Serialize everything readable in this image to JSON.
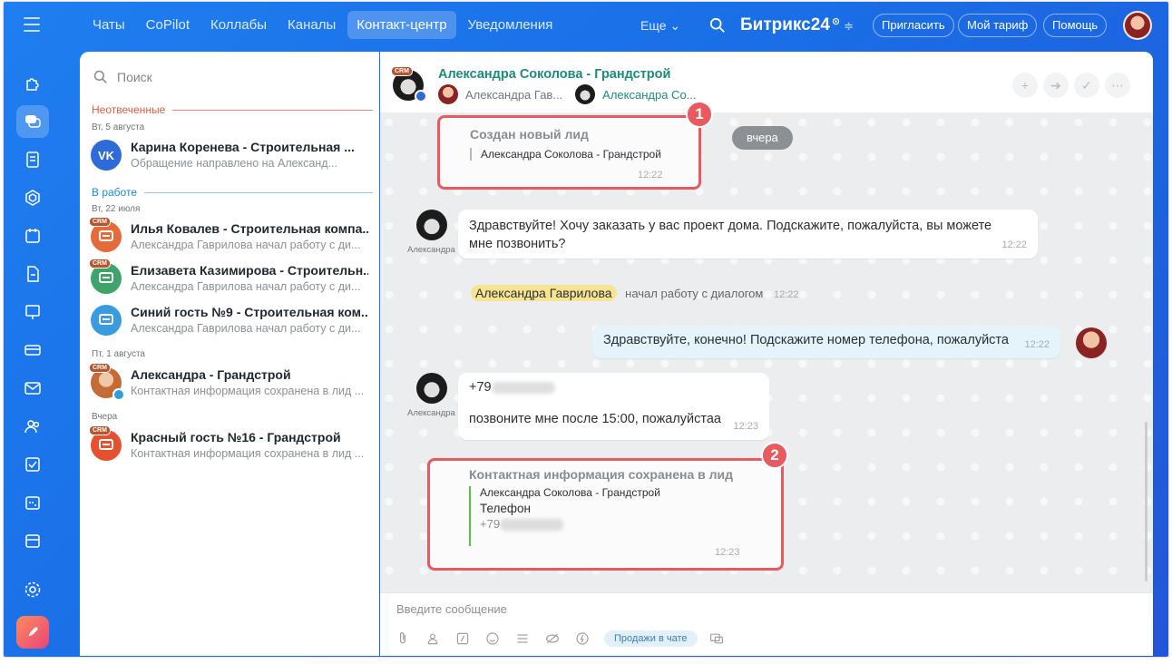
{
  "nav": {
    "items": [
      "Чаты",
      "CoPilot",
      "Коллабы",
      "Каналы",
      "Контакт-центр",
      "Уведомления"
    ],
    "active": "Контакт-центр",
    "more": "Еще"
  },
  "brand": {
    "name": "Битрикс",
    "num": "24"
  },
  "header_buttons": {
    "invite": "Пригласить",
    "plan": "Мой тариф",
    "help": "Помощь"
  },
  "recent": {
    "search_placeholder": "Поиск",
    "section_unanswered": "Неотвеченные",
    "section_in_work": "В работе",
    "dates": [
      "Вт, 5 августа",
      "Вт, 22 июля",
      "Пт, 1 августа",
      "Вчера"
    ],
    "items": [
      {
        "title": "Карина Коренева - Строительная ...",
        "subtitle": "Обращение направлено на Александ..."
      },
      {
        "title": "Илья Ковалев - Строительная компа...",
        "subtitle": "Александра Гаврилова начал работу с ди..."
      },
      {
        "title": "Елизавета Казимирова - Строительн...",
        "subtitle": "Александра Гаврилова начал работу с ди..."
      },
      {
        "title": "Синий гость №9 - Строительная ком...",
        "subtitle": "Александра Гаврилова начал работу с ди..."
      },
      {
        "title": "Александра - Грандстрой",
        "subtitle": "Контактная информация сохранена в лид ..."
      },
      {
        "title": "Красный гость №16 - Грандстрой",
        "subtitle": "Контактная информация сохранена в лид ..."
      }
    ],
    "crm_tag": "CRM"
  },
  "chat": {
    "title": "Александра Соколова - Грандстрой",
    "participants": [
      "Александра Гав...",
      "Александра Со..."
    ],
    "lead_created": {
      "title": "Создан новый лид",
      "body": "Александра Соколова - Грандстрой",
      "time": "12:22",
      "badge": "1"
    },
    "yesterday": "вчера",
    "msg1": {
      "text": "Здравствуйте! Хочу заказать у вас проект дома. Подскажите, пожалуйста, вы можете мне позвонить?",
      "time": "12:22",
      "author": "Александра"
    },
    "joined": {
      "name": "Александра Гаврилова",
      "text": "начал работу с диалогом",
      "time": "12:22"
    },
    "msg2": {
      "text": "Здравствуйте, конечно! Подскажите номер телефона, пожалуйста",
      "time": "12:22"
    },
    "msg3": {
      "phone": "+79",
      "text": "позвоните мне после 15:00, пожалуйстаа",
      "time": "12:23",
      "author": "Александра"
    },
    "contact_saved": {
      "title": "Контактная информация сохранена в лид",
      "lead": "Александра Соколова - Грандстрой",
      "phone_label": "Телефон",
      "phone": "+79",
      "time": "12:23",
      "badge": "2"
    }
  },
  "composer": {
    "placeholder": "Введите сообщение",
    "sales_button": "Продажи в чате"
  },
  "colors": {
    "accent": "#1f7ef0",
    "highlight": "#e85a5f",
    "crm": "#b7562e"
  }
}
